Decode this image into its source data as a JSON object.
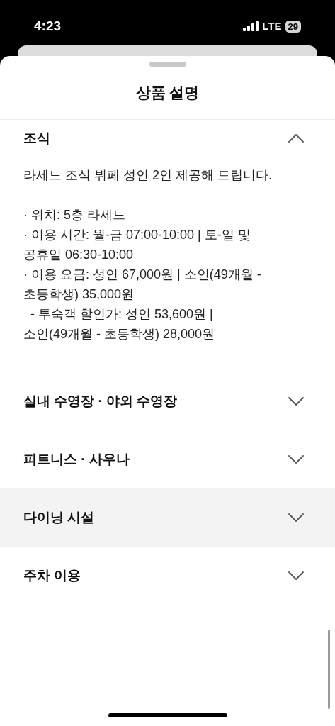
{
  "status_bar": {
    "time": "4:23",
    "network": "LTE",
    "battery": "29"
  },
  "sheet": {
    "title": "상품 설명"
  },
  "sections": [
    {
      "title": "조식",
      "expanded": true,
      "selected": false,
      "intro": "라세느 조식 뷔페 성인 2인 제공해 드립니다.",
      "lines": [
        "· 위치: 5층 라세느",
        "· 이용 시간: 월-금 07:00-10:00 | 토-일 및",
        "공휴일 06:30-10:00",
        "· 이용 요금: 성인 67,000원 | 소인(49개월 -",
        "초등학생) 35,000원",
        "  - 투숙객 할인가: 성인 53,600원 |",
        "소인(49개월 - 초등학생) 28,000원"
      ]
    },
    {
      "title": "실내 수영장 · 야외 수영장",
      "expanded": false,
      "selected": false
    },
    {
      "title": "피트니스 · 사우나",
      "expanded": false,
      "selected": false
    },
    {
      "title": "다이닝 시설",
      "expanded": false,
      "selected": true
    },
    {
      "title": "주차 이용",
      "expanded": false,
      "selected": false
    }
  ]
}
